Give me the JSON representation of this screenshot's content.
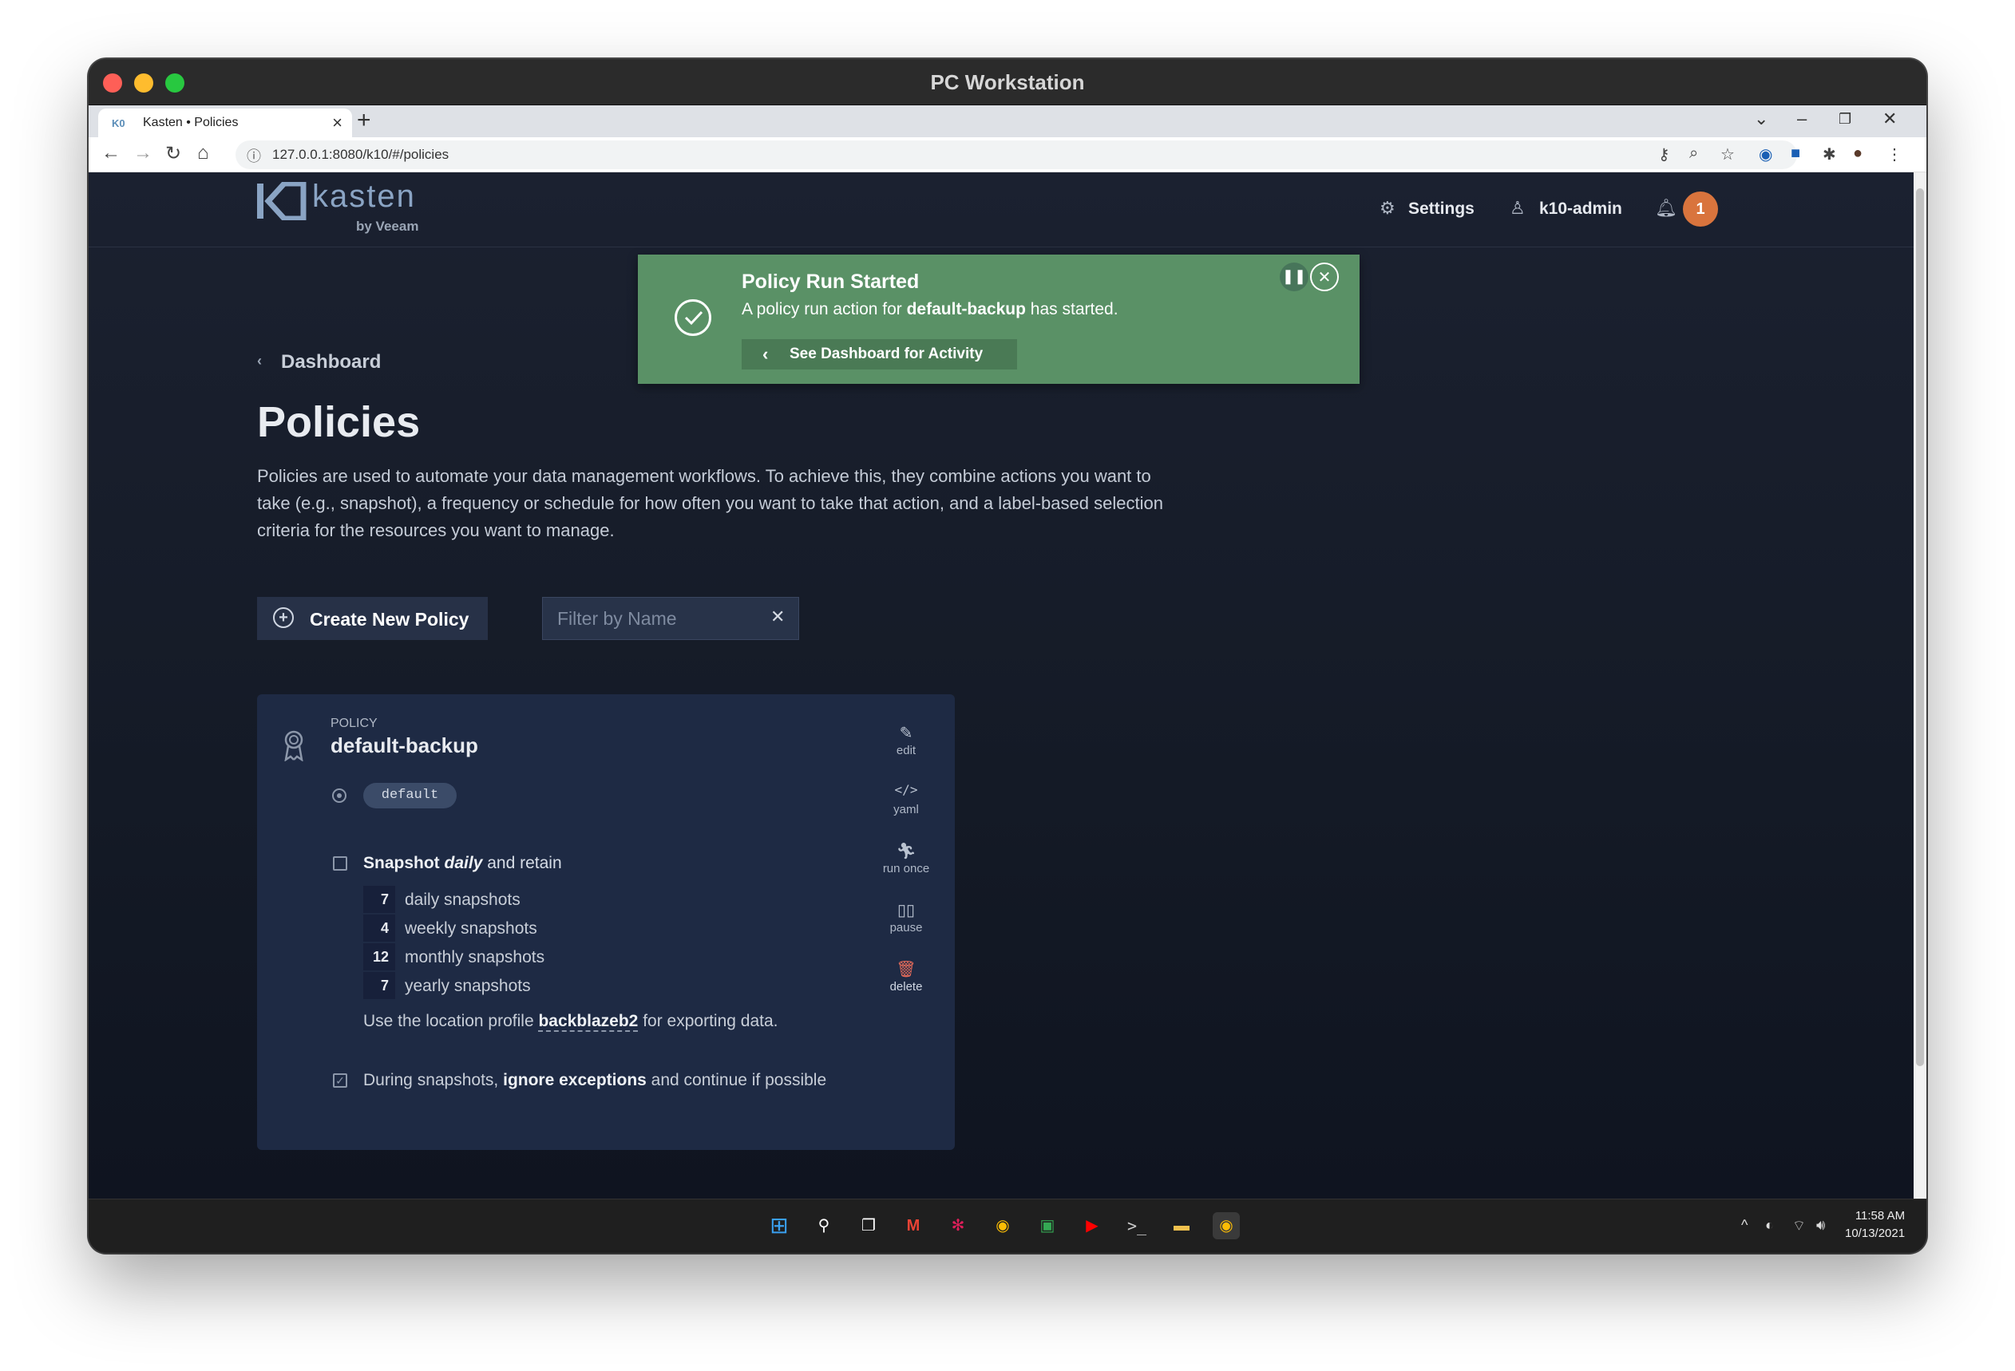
{
  "window": {
    "title": "PC Workstation"
  },
  "browser": {
    "tab_title": "Kasten • Policies",
    "tab_favicon": "K0",
    "url": "127.0.0.1:8080/k10/#/policies"
  },
  "header": {
    "logo_text": "kasten",
    "logo_sub": "by Veeam",
    "settings_label": "Settings",
    "user_label": "k10-admin",
    "notification_count": "1"
  },
  "toast": {
    "title": "Policy Run Started",
    "msg_prefix": "A policy run action for ",
    "msg_policy": "default-backup",
    "msg_suffix": " has started.",
    "button_label": "See Dashboard for Activity",
    "color": "#5a9166"
  },
  "page": {
    "breadcrumb": "Dashboard",
    "title": "Policies",
    "description": "Policies are used to automate your data management workflows. To achieve this, they combine actions you want to take (e.g., snapshot), a frequency or schedule for how often you want to take that action, and a label-based selection criteria for the resources you want to manage."
  },
  "controls": {
    "create_label": "Create New Policy",
    "filter_placeholder": "Filter by Name"
  },
  "policy": {
    "kicker": "POLICY",
    "name": "default-backup",
    "namespace": "default",
    "schedule_prefix": "Snapshot",
    "schedule_freq": "daily",
    "schedule_suffix": "and retain",
    "retention": [
      {
        "count": "7",
        "label": "daily snapshots"
      },
      {
        "count": "4",
        "label": "weekly snapshots"
      },
      {
        "count": "12",
        "label": "monthly snapshots"
      },
      {
        "count": "7",
        "label": "yearly snapshots"
      }
    ],
    "location_prefix": "Use the location profile ",
    "location_profile": "backblazeb2",
    "location_suffix": " for exporting data.",
    "exceptions_prefix": "During snapshots, ",
    "exceptions_bold": "ignore exceptions",
    "exceptions_suffix": " and continue if possible",
    "actions": {
      "edit": "edit",
      "yaml": "yaml",
      "run_once": "run once",
      "pause": "pause",
      "delete": "delete"
    }
  },
  "taskbar": {
    "time": "11:58 AM",
    "date": "10/13/2021"
  }
}
